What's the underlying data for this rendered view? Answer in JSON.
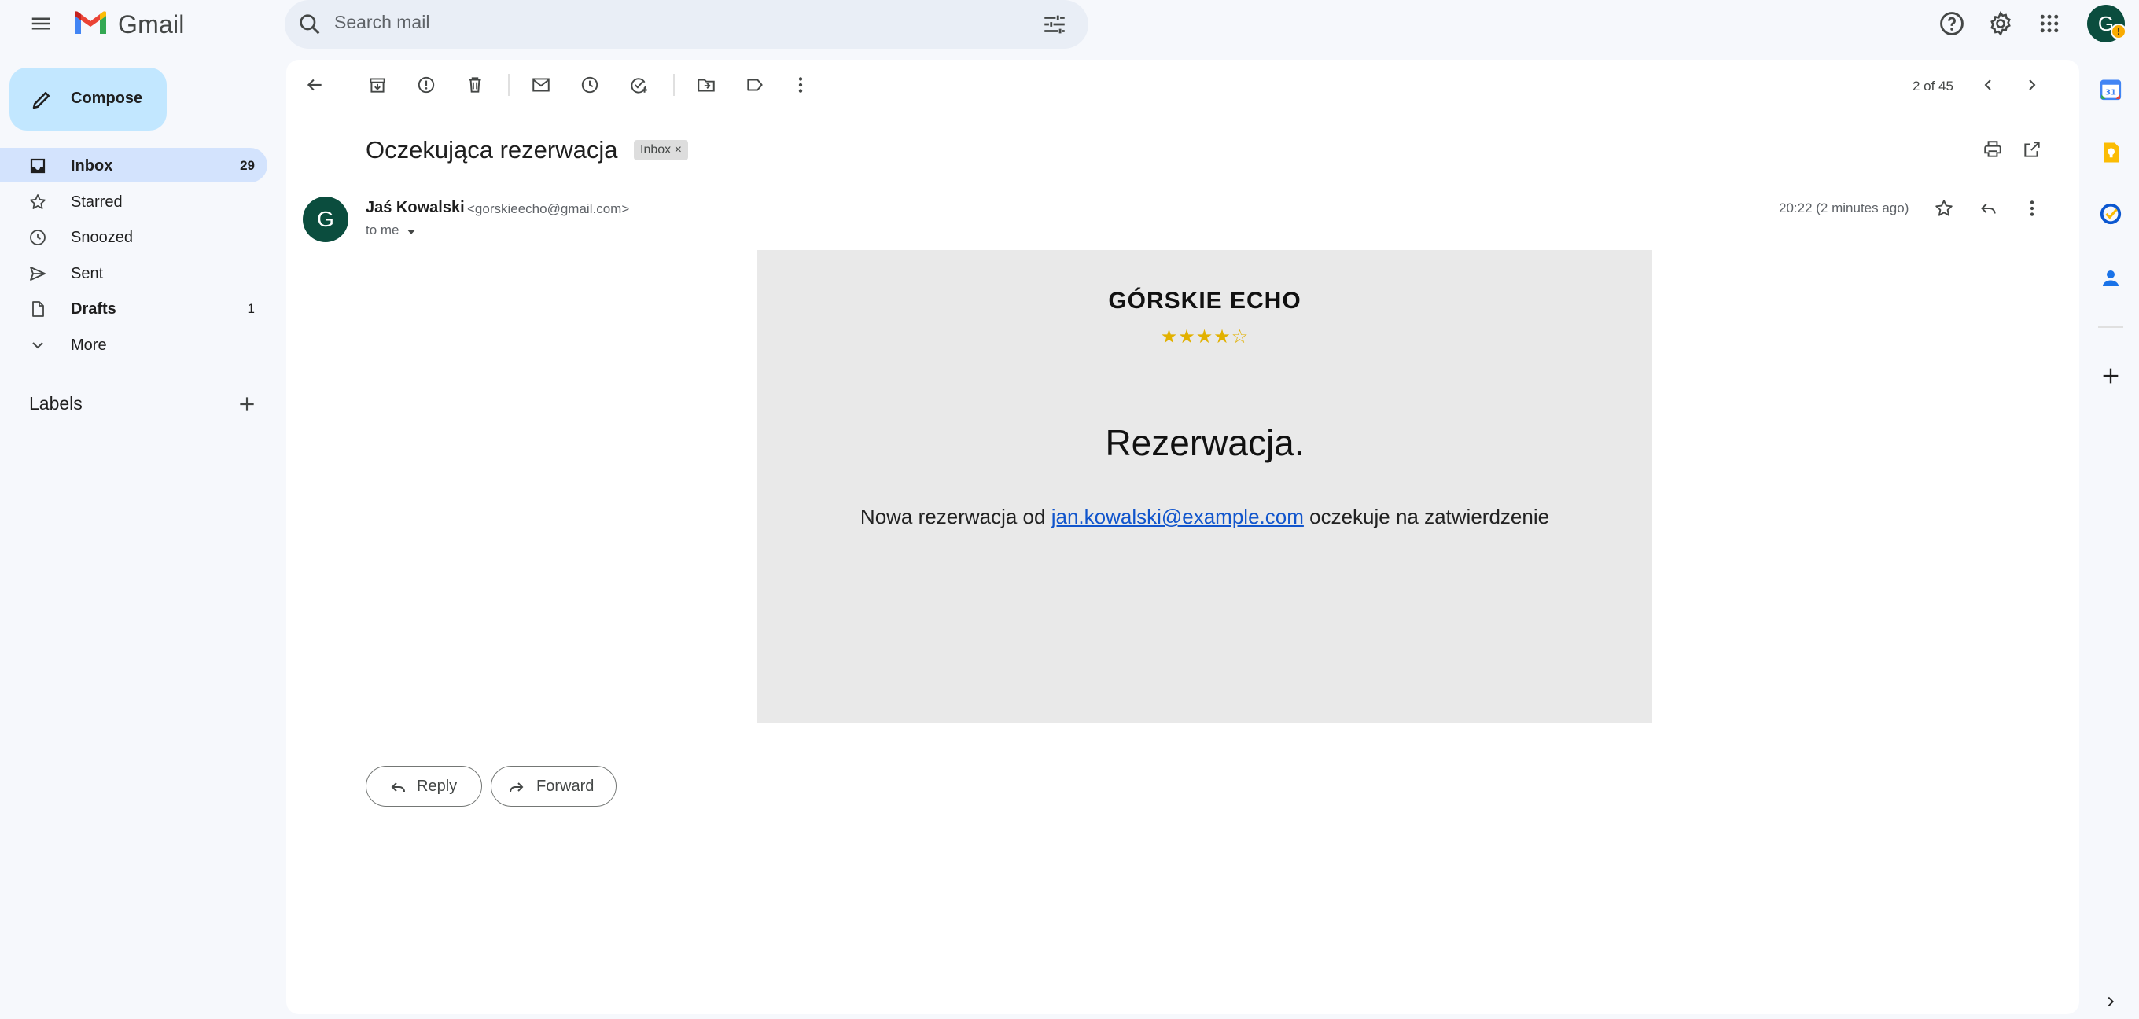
{
  "app": {
    "name": "Gmail"
  },
  "search": {
    "placeholder": "Search mail"
  },
  "compose": {
    "label": "Compose"
  },
  "nav": [
    {
      "label": "Inbox",
      "count": "29",
      "bold": true
    },
    {
      "label": "Starred",
      "count": ""
    },
    {
      "label": "Snoozed",
      "count": ""
    },
    {
      "label": "Sent",
      "count": ""
    },
    {
      "label": "Drafts",
      "count": "1",
      "bold": true
    },
    {
      "label": "More",
      "count": ""
    }
  ],
  "labels": {
    "title": "Labels"
  },
  "toolbar": {
    "page_count": "2 of 45"
  },
  "email": {
    "subject": "Oczekująca rezerwacja",
    "chip": "Inbox",
    "chip_close": "×",
    "sender_name": "Jaś Kowalski",
    "sender_email": "<gorskieecho@gmail.com>",
    "to": "to me",
    "timestamp": "20:22 (2 minutes ago)",
    "avatar_letter": "G",
    "body": {
      "brand": "GÓRSKIE ECHO",
      "stars": "★★★★☆",
      "rating": 4,
      "heading": "Rezerwacja.",
      "message_prefix": "Nowa rezerwacja od ",
      "message_link": "jan.kowalski@example.com",
      "message_suffix": " oczekuje na zatwierdzenie"
    }
  },
  "actions": {
    "reply": "Reply",
    "forward": "Forward"
  },
  "account": {
    "avatar_letter": "G"
  },
  "side_panel": {
    "calendar_day": "31"
  },
  "colors": {
    "accent": "#0b57d0",
    "compose_bg": "#c2e7ff",
    "selected_nav": "#d3e3fd",
    "avatar_bg": "#0b4d3e",
    "email_card_bg": "#e9e9e9",
    "stars": "#e2b100"
  }
}
